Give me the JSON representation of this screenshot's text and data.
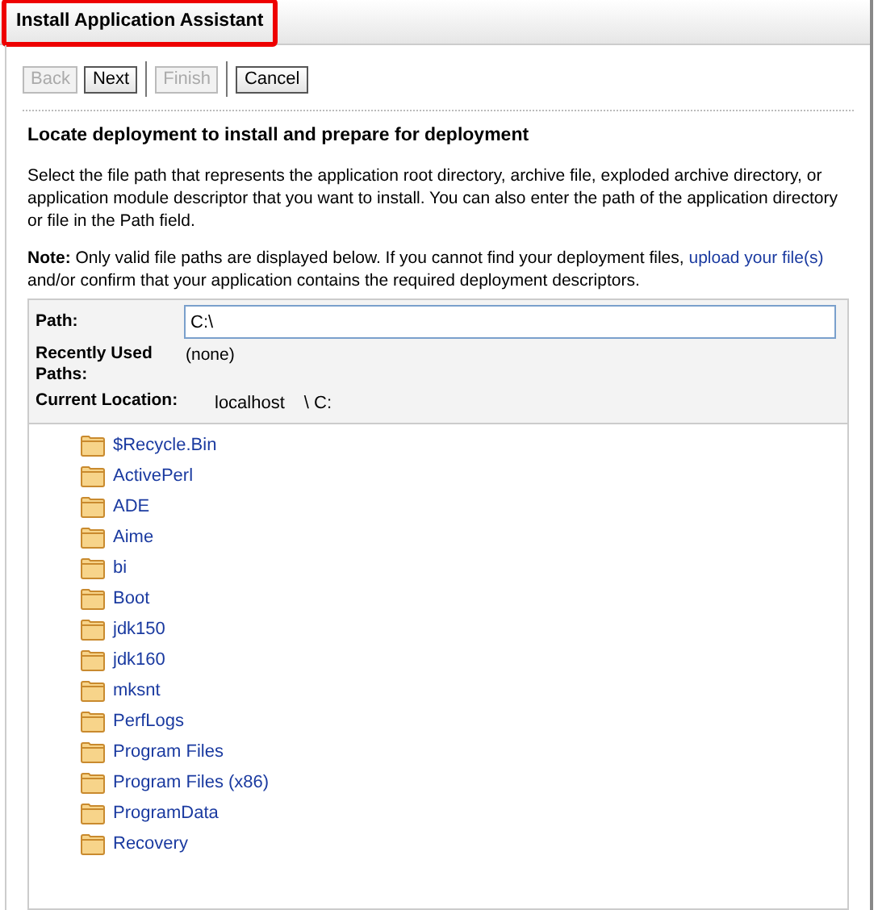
{
  "window": {
    "title": "Install Application Assistant",
    "highlighted": true
  },
  "buttons": [
    {
      "label": "Back",
      "disabled": true,
      "separator_before": false
    },
    {
      "label": "Next",
      "disabled": false,
      "separator_before": false
    },
    {
      "label": "Finish",
      "disabled": true,
      "separator_before": true
    },
    {
      "label": "Cancel",
      "disabled": false,
      "separator_before": true
    }
  ],
  "heading": "Locate deployment to install and prepare for deployment",
  "description": "Select the file path that represents the application root directory, archive file, exploded archive directory, or application module descriptor that you want to install. You can also enter the path of the application directory or file in the Path field.",
  "note": {
    "label": "Note:",
    "text_before": "Only valid file paths are displayed below. If you cannot find your deployment files,",
    "link": "upload your file(s)",
    "text_after": "and/or confirm that your application contains the required deployment descriptors."
  },
  "form": {
    "path_label": "Path:",
    "path_value": "C:\\",
    "recent_label": "Recently Used Paths:",
    "recent_value": "(none)",
    "location_label": "Current Location:",
    "location_host": "localhost",
    "location_path": "\\ C:"
  },
  "folders": [
    "$Recycle.Bin",
    "ActivePerl",
    "ADE",
    "Aime",
    "bi",
    "Boot",
    "jdk150",
    "jdk160",
    "mksnt",
    "PerfLogs",
    "Program Files",
    "Program Files (x86)",
    "ProgramData",
    "Recovery"
  ]
}
